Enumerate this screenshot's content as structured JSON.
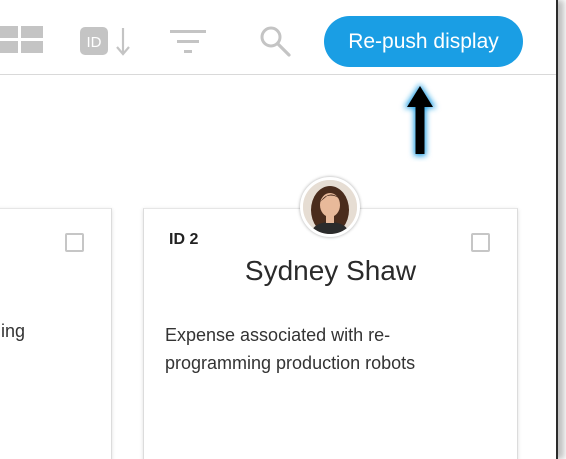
{
  "toolbar": {
    "icons": [
      "grid-view-icon",
      "id-sort-icon",
      "filter-icon",
      "search-icon"
    ],
    "id_sort_label": "ID",
    "repush_label": "Re-push display"
  },
  "cards": [
    {
      "description": "ging"
    },
    {
      "id_label": "ID 2",
      "name": "Sydney Shaw",
      "description": "Expense associated with re-programming production robots"
    }
  ],
  "colors": {
    "accent": "#1a9ee4",
    "arrow": "#000000",
    "arrow_glow": "#1a9ee4",
    "icon_gray": "#c4c4c4",
    "card_border": "#dcdcdc"
  }
}
